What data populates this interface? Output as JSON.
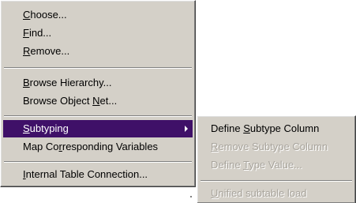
{
  "context_menu": {
    "items": [
      {
        "label": "Choose...",
        "accel": "C",
        "rest": "hoose..."
      },
      {
        "label": "Find...",
        "accel": "F",
        "rest": "ind..."
      },
      {
        "label": "Remove...",
        "accel": "R",
        "rest": "emove..."
      },
      {
        "label": "Browse Hierarchy...",
        "accel": "B",
        "rest": "rowse Hierarchy..."
      },
      {
        "label": "Browse Object Net...",
        "pre": "Browse Object ",
        "accel": "N",
        "rest": "et..."
      },
      {
        "label": "Subtyping",
        "accel": "S",
        "rest": "ubtyping",
        "selected": true,
        "has_submenu": true
      },
      {
        "label": "Map Corresponding Variables",
        "pre": "Map Co",
        "accel": "r",
        "rest": "responding Variables"
      },
      {
        "label": "Internal Table Connection...",
        "accel": "I",
        "rest": "nternal Table Connection..."
      }
    ]
  },
  "submenu": {
    "items": [
      {
        "label": "Define Subtype Column",
        "pre": "Define ",
        "accel": "S",
        "rest": "ubtype Column",
        "enabled": true
      },
      {
        "label": "Remove Subtype Column",
        "accel": "R",
        "rest": "emove Subtype Column",
        "enabled": false
      },
      {
        "label": "Define Type Value...",
        "pre": "Define ",
        "accel": "T",
        "rest": "ype Value...",
        "enabled": false
      },
      {
        "label": "Unified subtable load",
        "accel": "U",
        "rest": "nified subtable load",
        "enabled": false
      }
    ]
  },
  "colors": {
    "menu_background": "#d4d0c8",
    "selection_background": "#3f1068",
    "selection_text": "#ffffff",
    "disabled_text": "#a8a49c"
  }
}
